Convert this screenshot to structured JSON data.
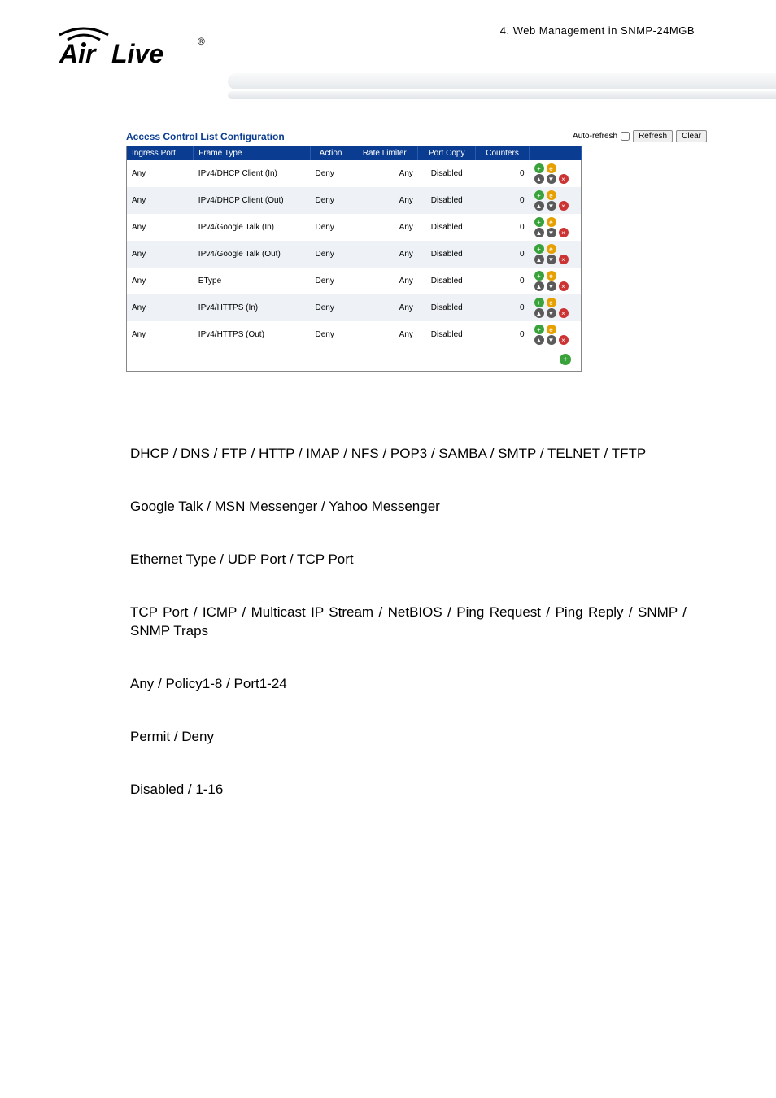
{
  "header": {
    "breadcrumb": "4.  Web Management in SNMP-24MGB",
    "logo_text_top": "Air",
    "logo_text_bottom": "Live"
  },
  "acl": {
    "title": "Access Control List Configuration",
    "autorefresh_label": "Auto-refresh",
    "refresh_label": "Refresh",
    "clear_label": "Clear",
    "cols": {
      "ingress": "Ingress Port",
      "frame": "Frame Type",
      "action": "Action",
      "rate": "Rate Limiter",
      "portcopy": "Port Copy",
      "counters": "Counters"
    },
    "rows": [
      {
        "ingress": "Any",
        "frame": "IPv4/DHCP Client (In)",
        "action": "Deny",
        "rate": "Any",
        "portcopy": "Disabled",
        "counters": "0"
      },
      {
        "ingress": "Any",
        "frame": "IPv4/DHCP Client (Out)",
        "action": "Deny",
        "rate": "Any",
        "portcopy": "Disabled",
        "counters": "0"
      },
      {
        "ingress": "Any",
        "frame": "IPv4/Google Talk (In)",
        "action": "Deny",
        "rate": "Any",
        "portcopy": "Disabled",
        "counters": "0"
      },
      {
        "ingress": "Any",
        "frame": "IPv4/Google Talk (Out)",
        "action": "Deny",
        "rate": "Any",
        "portcopy": "Disabled",
        "counters": "0"
      },
      {
        "ingress": "Any",
        "frame": "EType",
        "action": "Deny",
        "rate": "Any",
        "portcopy": "Disabled",
        "counters": "0"
      },
      {
        "ingress": "Any",
        "frame": "IPv4/HTTPS (In)",
        "action": "Deny",
        "rate": "Any",
        "portcopy": "Disabled",
        "counters": "0"
      },
      {
        "ingress": "Any",
        "frame": "IPv4/HTTPS (Out)",
        "action": "Deny",
        "rate": "Any",
        "portcopy": "Disabled",
        "counters": "0"
      }
    ]
  },
  "body": {
    "p1": "DHCP / DNS / FTP / HTTP / IMAP / NFS / POP3 / SAMBA / SMTP / TELNET / TFTP",
    "p2": "Google Talk / MSN Messenger / Yahoo Messenger",
    "p3": "Ethernet Type / UDP Port / TCP Port",
    "p4": "TCP Port / ICMP / Multicast IP Stream / NetBIOS / Ping Request / Ping Reply / SNMP / SNMP Traps",
    "p5": "Any / Policy1-8 / Port1-24",
    "p6": "Permit / Deny",
    "p7": "Disabled / 1-16"
  }
}
